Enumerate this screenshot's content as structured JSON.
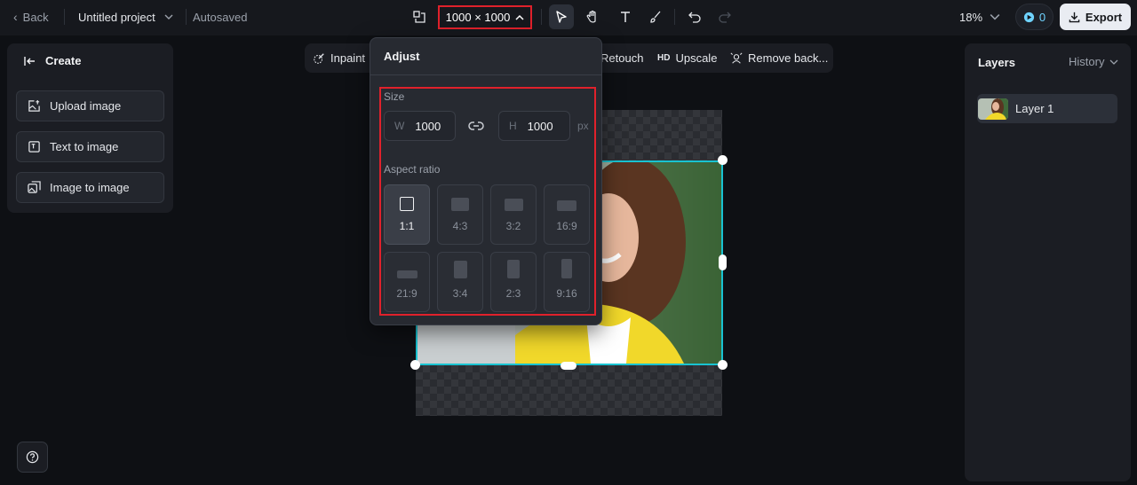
{
  "topbar": {
    "back_label": "Back",
    "project_title": "Untitled project",
    "autosave_status": "Autosaved",
    "canvas_size": "1000 × 1000",
    "zoom": "18%",
    "credits": "0",
    "export_label": "Export"
  },
  "left_panel": {
    "title": "Create",
    "buttons": [
      "Upload image",
      "Text to image",
      "Image to image"
    ]
  },
  "edit_toolbar": {
    "items": [
      "Inpaint",
      "Retouch",
      "Upscale",
      "Remove back..."
    ],
    "upscale_badge": "HD"
  },
  "right_panel": {
    "title": "Layers",
    "history_label": "History",
    "layers": [
      {
        "name": "Layer 1"
      }
    ]
  },
  "adjust": {
    "title": "Adjust",
    "size_label": "Size",
    "width_prefix": "W",
    "width_value": "1000",
    "height_prefix": "H",
    "height_value": "1000",
    "unit": "px",
    "aspect_label": "Aspect ratio",
    "ratios": [
      {
        "label": "1:1",
        "selected": true
      },
      {
        "label": "4:3",
        "selected": false
      },
      {
        "label": "3:2",
        "selected": false
      },
      {
        "label": "16:9",
        "selected": false
      },
      {
        "label": "21:9",
        "selected": false
      },
      {
        "label": "3:4",
        "selected": false
      },
      {
        "label": "2:3",
        "selected": false
      },
      {
        "label": "9:16",
        "selected": false
      }
    ]
  },
  "colors": {
    "accent_highlight": "#e0212b",
    "selection": "#19c3d1",
    "background": "#0e1014"
  }
}
